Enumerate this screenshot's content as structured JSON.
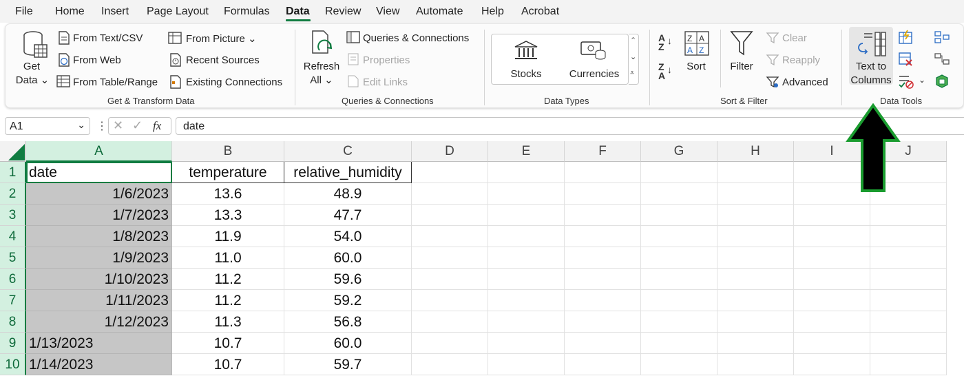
{
  "menu": {
    "tabs": [
      "File",
      "Home",
      "Insert",
      "Page Layout",
      "Formulas",
      "Data",
      "Review",
      "View",
      "Automate",
      "Help",
      "Acrobat"
    ],
    "active_tab": "Data"
  },
  "ribbon": {
    "get_transform": {
      "get_data_line1": "Get",
      "get_data_line2": "Data",
      "from_text_csv": "From Text/CSV",
      "from_web": "From Web",
      "from_table_range": "From Table/Range",
      "from_picture": "From Picture",
      "recent_sources": "Recent Sources",
      "existing_connections": "Existing Connections",
      "group_label": "Get & Transform Data"
    },
    "queries": {
      "refresh_line1": "Refresh",
      "refresh_line2": "All",
      "queries_connections": "Queries & Connections",
      "properties": "Properties",
      "edit_links": "Edit Links",
      "group_label": "Queries & Connections"
    },
    "data_types": {
      "stocks": "Stocks",
      "currencies": "Currencies",
      "group_label": "Data Types"
    },
    "sort_filter": {
      "sort": "Sort",
      "filter": "Filter",
      "clear": "Clear",
      "reapply": "Reapply",
      "advanced": "Advanced",
      "group_label": "Sort & Filter"
    },
    "data_tools": {
      "text_to_columns_line1": "Text to",
      "text_to_columns_line2": "Columns",
      "group_label": "Data Tools"
    }
  },
  "formula_bar": {
    "name_box": "A1",
    "fx": "fx",
    "formula": "date"
  },
  "sheet": {
    "columns": [
      "A",
      "B",
      "C",
      "D",
      "E",
      "F",
      "G",
      "H",
      "I",
      "J"
    ],
    "rows": [
      "1",
      "2",
      "3",
      "4",
      "5",
      "6",
      "7",
      "8",
      "9",
      "10"
    ],
    "header": [
      "date",
      "temperature",
      "relative_humidity"
    ],
    "data": [
      [
        "1/6/2023",
        "13.6",
        "48.9"
      ],
      [
        "1/7/2023",
        "13.3",
        "47.7"
      ],
      [
        "1/8/2023",
        "11.9",
        "54.0"
      ],
      [
        "1/9/2023",
        "11.0",
        "60.0"
      ],
      [
        "1/10/2023",
        "11.2",
        "59.6"
      ],
      [
        "1/11/2023",
        "11.2",
        "59.2"
      ],
      [
        "1/12/2023",
        "11.3",
        "56.8"
      ],
      [
        "1/13/2023",
        "10.7",
        "60.0"
      ],
      [
        "1/14/2023",
        "10.7",
        "59.7"
      ]
    ]
  },
  "colors": {
    "accent_green": "#107c41",
    "arrow_fill": "#000000",
    "arrow_outline": "#1a9c2f",
    "selection_grey": "#c6c6c6"
  }
}
